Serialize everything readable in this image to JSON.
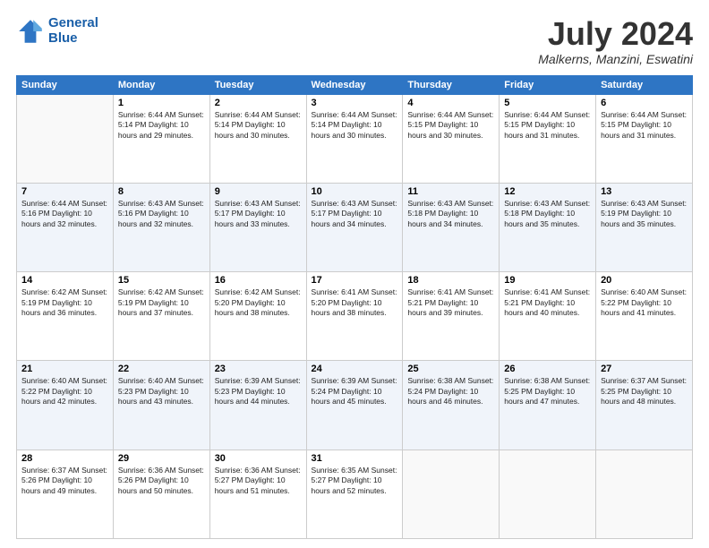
{
  "header": {
    "logo_line1": "General",
    "logo_line2": "Blue",
    "month_title": "July 2024",
    "location": "Malkerns, Manzini, Eswatini"
  },
  "days_of_week": [
    "Sunday",
    "Monday",
    "Tuesday",
    "Wednesday",
    "Thursday",
    "Friday",
    "Saturday"
  ],
  "weeks": [
    [
      {
        "day": "",
        "info": ""
      },
      {
        "day": "1",
        "info": "Sunrise: 6:44 AM\nSunset: 5:14 PM\nDaylight: 10 hours\nand 29 minutes."
      },
      {
        "day": "2",
        "info": "Sunrise: 6:44 AM\nSunset: 5:14 PM\nDaylight: 10 hours\nand 30 minutes."
      },
      {
        "day": "3",
        "info": "Sunrise: 6:44 AM\nSunset: 5:14 PM\nDaylight: 10 hours\nand 30 minutes."
      },
      {
        "day": "4",
        "info": "Sunrise: 6:44 AM\nSunset: 5:15 PM\nDaylight: 10 hours\nand 30 minutes."
      },
      {
        "day": "5",
        "info": "Sunrise: 6:44 AM\nSunset: 5:15 PM\nDaylight: 10 hours\nand 31 minutes."
      },
      {
        "day": "6",
        "info": "Sunrise: 6:44 AM\nSunset: 5:15 PM\nDaylight: 10 hours\nand 31 minutes."
      }
    ],
    [
      {
        "day": "7",
        "info": "Sunrise: 6:44 AM\nSunset: 5:16 PM\nDaylight: 10 hours\nand 32 minutes."
      },
      {
        "day": "8",
        "info": "Sunrise: 6:43 AM\nSunset: 5:16 PM\nDaylight: 10 hours\nand 32 minutes."
      },
      {
        "day": "9",
        "info": "Sunrise: 6:43 AM\nSunset: 5:17 PM\nDaylight: 10 hours\nand 33 minutes."
      },
      {
        "day": "10",
        "info": "Sunrise: 6:43 AM\nSunset: 5:17 PM\nDaylight: 10 hours\nand 34 minutes."
      },
      {
        "day": "11",
        "info": "Sunrise: 6:43 AM\nSunset: 5:18 PM\nDaylight: 10 hours\nand 34 minutes."
      },
      {
        "day": "12",
        "info": "Sunrise: 6:43 AM\nSunset: 5:18 PM\nDaylight: 10 hours\nand 35 minutes."
      },
      {
        "day": "13",
        "info": "Sunrise: 6:43 AM\nSunset: 5:19 PM\nDaylight: 10 hours\nand 35 minutes."
      }
    ],
    [
      {
        "day": "14",
        "info": "Sunrise: 6:42 AM\nSunset: 5:19 PM\nDaylight: 10 hours\nand 36 minutes."
      },
      {
        "day": "15",
        "info": "Sunrise: 6:42 AM\nSunset: 5:19 PM\nDaylight: 10 hours\nand 37 minutes."
      },
      {
        "day": "16",
        "info": "Sunrise: 6:42 AM\nSunset: 5:20 PM\nDaylight: 10 hours\nand 38 minutes."
      },
      {
        "day": "17",
        "info": "Sunrise: 6:41 AM\nSunset: 5:20 PM\nDaylight: 10 hours\nand 38 minutes."
      },
      {
        "day": "18",
        "info": "Sunrise: 6:41 AM\nSunset: 5:21 PM\nDaylight: 10 hours\nand 39 minutes."
      },
      {
        "day": "19",
        "info": "Sunrise: 6:41 AM\nSunset: 5:21 PM\nDaylight: 10 hours\nand 40 minutes."
      },
      {
        "day": "20",
        "info": "Sunrise: 6:40 AM\nSunset: 5:22 PM\nDaylight: 10 hours\nand 41 minutes."
      }
    ],
    [
      {
        "day": "21",
        "info": "Sunrise: 6:40 AM\nSunset: 5:22 PM\nDaylight: 10 hours\nand 42 minutes."
      },
      {
        "day": "22",
        "info": "Sunrise: 6:40 AM\nSunset: 5:23 PM\nDaylight: 10 hours\nand 43 minutes."
      },
      {
        "day": "23",
        "info": "Sunrise: 6:39 AM\nSunset: 5:23 PM\nDaylight: 10 hours\nand 44 minutes."
      },
      {
        "day": "24",
        "info": "Sunrise: 6:39 AM\nSunset: 5:24 PM\nDaylight: 10 hours\nand 45 minutes."
      },
      {
        "day": "25",
        "info": "Sunrise: 6:38 AM\nSunset: 5:24 PM\nDaylight: 10 hours\nand 46 minutes."
      },
      {
        "day": "26",
        "info": "Sunrise: 6:38 AM\nSunset: 5:25 PM\nDaylight: 10 hours\nand 47 minutes."
      },
      {
        "day": "27",
        "info": "Sunrise: 6:37 AM\nSunset: 5:25 PM\nDaylight: 10 hours\nand 48 minutes."
      }
    ],
    [
      {
        "day": "28",
        "info": "Sunrise: 6:37 AM\nSunset: 5:26 PM\nDaylight: 10 hours\nand 49 minutes."
      },
      {
        "day": "29",
        "info": "Sunrise: 6:36 AM\nSunset: 5:26 PM\nDaylight: 10 hours\nand 50 minutes."
      },
      {
        "day": "30",
        "info": "Sunrise: 6:36 AM\nSunset: 5:27 PM\nDaylight: 10 hours\nand 51 minutes."
      },
      {
        "day": "31",
        "info": "Sunrise: 6:35 AM\nSunset: 5:27 PM\nDaylight: 10 hours\nand 52 minutes."
      },
      {
        "day": "",
        "info": ""
      },
      {
        "day": "",
        "info": ""
      },
      {
        "day": "",
        "info": ""
      }
    ]
  ]
}
